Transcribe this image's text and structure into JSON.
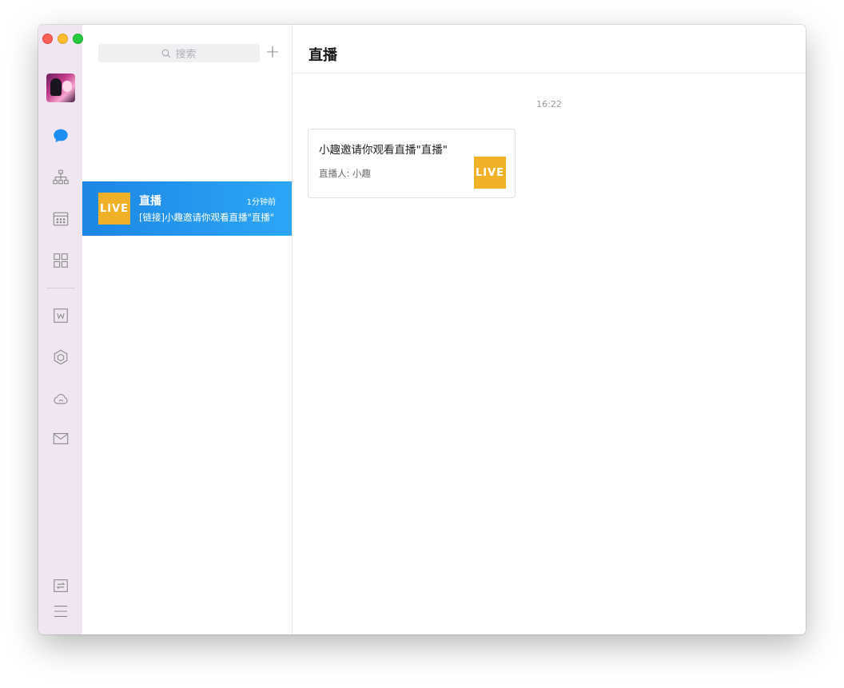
{
  "window": {
    "traffic_lights": [
      "close",
      "minimize",
      "maximize"
    ]
  },
  "rail": {
    "icons": [
      {
        "name": "chat-icon",
        "active": true,
        "color": "#1e8ff0"
      },
      {
        "name": "org-chart-icon"
      },
      {
        "name": "calendar-icon"
      },
      {
        "name": "apps-grid-icon"
      },
      {
        "name": "word-doc-icon"
      },
      {
        "name": "cube-icon"
      },
      {
        "name": "cloud-icon"
      },
      {
        "name": "mail-icon"
      },
      {
        "name": "transfer-icon"
      },
      {
        "name": "menu-icon"
      }
    ]
  },
  "list": {
    "search_placeholder": "搜索",
    "add_label": "+",
    "conversations": [
      {
        "badge": "LIVE",
        "title": "直播",
        "time": "1分钟前",
        "preview": "[链接]小趣邀请你观看直播\"直播\"",
        "selected": true
      }
    ]
  },
  "chat": {
    "title": "直播",
    "timestamp": "16:22",
    "card": {
      "title": "小趣邀请你观看直播\"直播\"",
      "host": "直播人: 小趣",
      "badge": "LIVE"
    }
  },
  "colors": {
    "accent": "#1e8ff0",
    "live_badge": "#f0b128",
    "rail_bg": "#efe6f1"
  }
}
